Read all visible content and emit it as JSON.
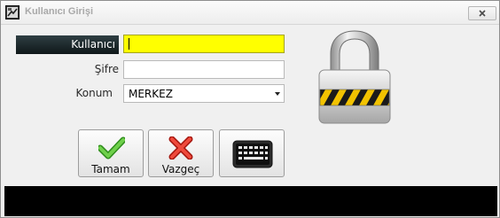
{
  "window": {
    "title": "Kullanıcı Girişi"
  },
  "form": {
    "user_label": "Kullanıcı",
    "user_value": "",
    "password_label": "Şifre",
    "password_value": "",
    "location_label": "Konum",
    "location_value": "MERKEZ"
  },
  "buttons": {
    "ok_label": "Tamam",
    "cancel_label": "Vazgeç"
  },
  "icons": {
    "app": "app-icon",
    "close": "close-icon",
    "ok": "check-icon",
    "cancel": "x-icon",
    "keyboard": "keyboard-icon",
    "lock": "padlock-icon"
  },
  "colors": {
    "active_field": "#ffff00",
    "active_label_bg": "#1a2326",
    "ok_icon": "#4cb530",
    "cancel_icon": "#d8281f",
    "status_bar": "#000000"
  }
}
